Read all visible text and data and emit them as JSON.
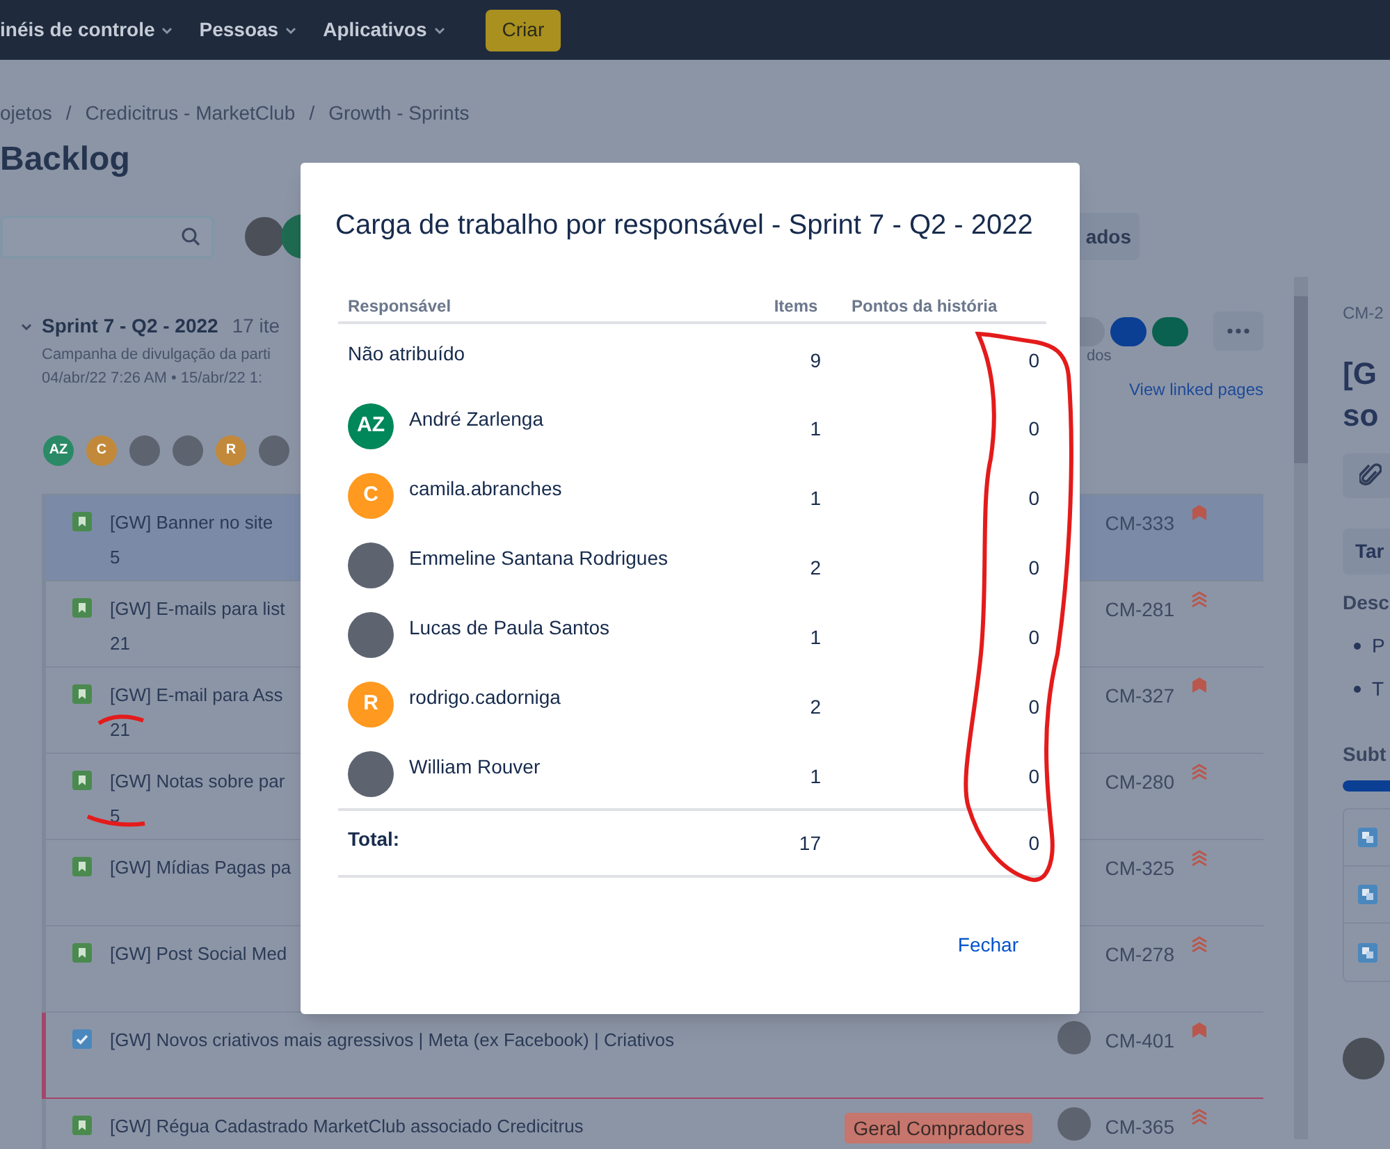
{
  "top_nav": {
    "items": [
      {
        "label": "inéis de controle"
      },
      {
        "label": "Pessoas"
      },
      {
        "label": "Aplicativos"
      }
    ],
    "create_button": "Criar"
  },
  "breadcrumbs": {
    "separator": "/",
    "items": [
      "ojetos",
      "Credicitrus - MarketClub",
      "Growth - Sprints"
    ]
  },
  "page_title": "Backlog",
  "toolbar": {
    "filter_button": "ados"
  },
  "sprint": {
    "name": "Sprint 7 - Q2 - 2022",
    "count": "17 ite",
    "goal": "Campanha de divulgação da parti",
    "dates": "04/abr/22 7:26 AM • 15/abr/22 1:",
    "status_fragment": "dos",
    "linked_pages": "View linked pages",
    "assignees": [
      {
        "kind": "initials",
        "initials": "AZ",
        "color": "#2a8a66"
      },
      {
        "kind": "initials",
        "initials": "C",
        "color": "#c2893a"
      },
      {
        "kind": "photo"
      },
      {
        "kind": "photo"
      },
      {
        "kind": "initials",
        "initials": "R",
        "color": "#c2893a"
      },
      {
        "kind": "photo"
      }
    ]
  },
  "issues": [
    {
      "kind": "story",
      "title": "[GW] Banner no site",
      "points": "5",
      "key": "CM-333",
      "priority": {
        "kind": "high"
      },
      "selected": true
    },
    {
      "kind": "story",
      "title": "[GW] E-mails para list",
      "points": "21",
      "key": "CM-281",
      "priority": {
        "kind": "highest"
      },
      "selected": false
    },
    {
      "kind": "story",
      "title": "[GW] E-mail para Ass",
      "points": "21",
      "key": "CM-327",
      "priority": {
        "kind": "high"
      },
      "selected": false
    },
    {
      "kind": "story",
      "title": "[GW] Notas sobre par",
      "points": "5",
      "key": "CM-280",
      "priority": {
        "kind": "highest"
      },
      "selected": false
    },
    {
      "kind": "story",
      "title": "[GW] Mídias Pagas pa",
      "key": "CM-325",
      "priority": {
        "kind": "highest"
      },
      "selected": false
    },
    {
      "kind": "story",
      "title": "[GW] Post Social Med",
      "key": "CM-278",
      "priority": {
        "kind": "highest"
      },
      "selected": false
    },
    {
      "kind": "task",
      "title": "[GW] Novos criativos mais agressivos | Meta (ex Facebook) | Criativos",
      "key": "CM-401",
      "priority": {
        "kind": "high"
      },
      "selected": false,
      "assignee": {
        "kind": "photo"
      }
    },
    {
      "kind": "story",
      "title": "[GW] Régua Cadastrado MarketClub associado Credicitrus",
      "epic": "Geral Compradores",
      "key": "CM-365",
      "priority": {
        "kind": "highest"
      },
      "selected": false,
      "assignee": {
        "kind": "photo"
      }
    }
  ],
  "detail_panel": {
    "key": "CM-2",
    "title_lines": [
      "[G",
      "so"
    ],
    "tab": "Tar",
    "description_label": "Desc",
    "bullets": [
      "P",
      "T"
    ],
    "subtasks_label": "Subt",
    "subtasks_progress": {
      "level": 1
    }
  },
  "dialog": {
    "title": "Carga de trabalho por responsável - Sprint 7 - Q2 - 2022",
    "columns": [
      "Responsável",
      "Items",
      "Pontos da história"
    ],
    "rows": [
      {
        "name": "Não atribuído",
        "items": "9",
        "points": "0"
      },
      {
        "name": "André Zarlenga",
        "items": "1",
        "points": "0",
        "avatar": {
          "kind": "initials",
          "initials": "AZ",
          "color": "#00875a"
        }
      },
      {
        "name": "camila.abranches",
        "items": "1",
        "points": "0",
        "avatar": {
          "kind": "initials",
          "initials": "C",
          "color": "#ff991f"
        }
      },
      {
        "name": "Emmeline Santana Rodrigues",
        "items": "2",
        "points": "0",
        "avatar": {
          "kind": "photo"
        }
      },
      {
        "name": "Lucas de Paula Santos",
        "items": "1",
        "points": "0",
        "avatar": {
          "kind": "photo"
        }
      },
      {
        "name": "rodrigo.cadorniga",
        "items": "2",
        "points": "0",
        "avatar": {
          "kind": "initials",
          "initials": "R",
          "color": "#ff991f"
        }
      },
      {
        "name": "William Rouver",
        "items": "1",
        "points": "0",
        "avatar": {
          "kind": "photo"
        }
      }
    ],
    "total": {
      "label": "Total:",
      "items": "17",
      "points": "0"
    },
    "close_button": "Fechar"
  }
}
